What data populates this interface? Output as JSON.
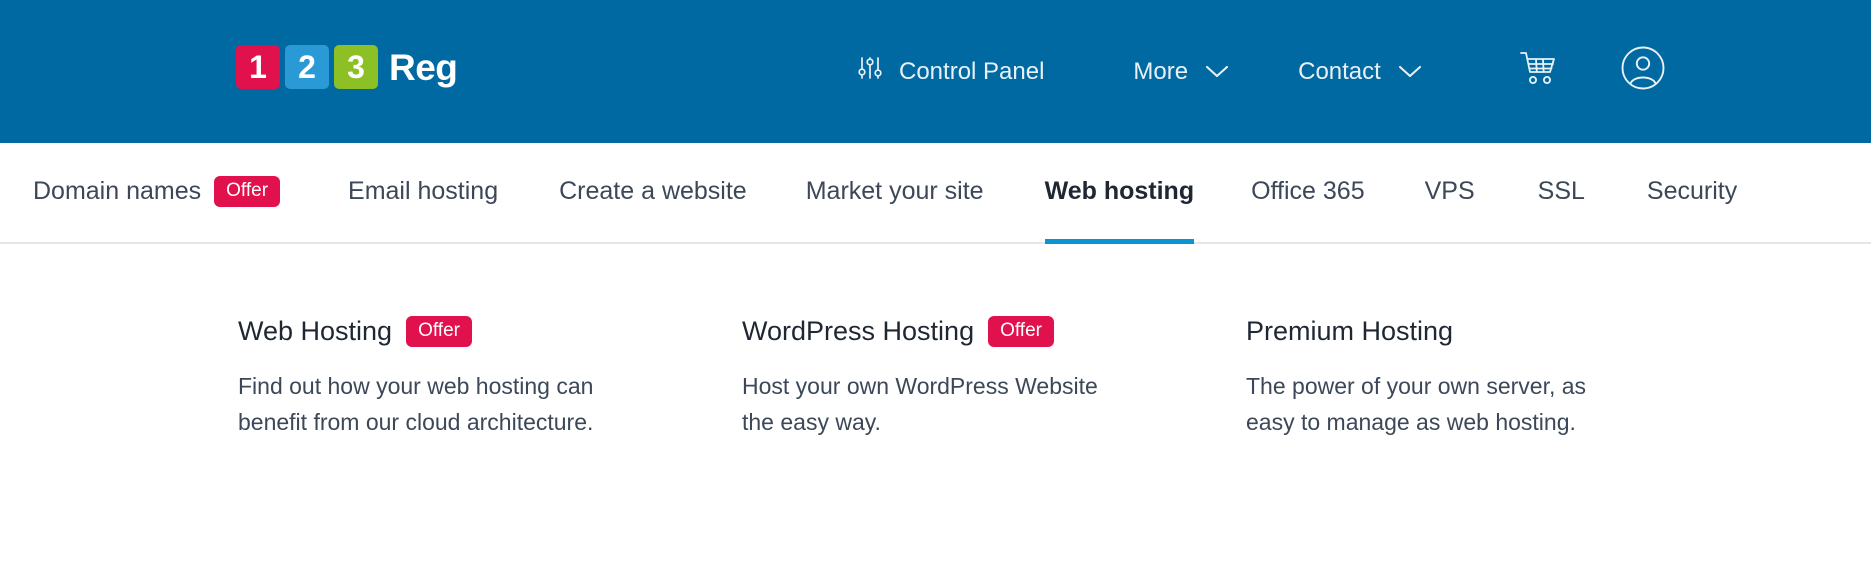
{
  "colors": {
    "header_blue": "#0069a2",
    "accent_blue": "#0d93d2",
    "badge_pink": "#e0114d",
    "logo_1": "#e0114d",
    "logo_2": "#2a9ad6",
    "logo_3": "#8cc024",
    "text_dark": "#1f2733",
    "text_body": "#3c4858"
  },
  "header": {
    "logo": {
      "tiles": [
        "1",
        "2",
        "3"
      ],
      "word": "Reg"
    },
    "items": [
      {
        "label": "Control Panel",
        "icon": "sliders-icon"
      },
      {
        "label": "More",
        "icon": "chevron-down-icon"
      },
      {
        "label": "Contact",
        "icon": "chevron-down-icon"
      }
    ],
    "cart_icon": "shopping-cart-icon",
    "account_icon": "user-account-icon"
  },
  "main_nav": {
    "items": [
      {
        "label": "Domain names",
        "badge": "Offer",
        "active": false
      },
      {
        "label": "Email hosting",
        "badge": null,
        "active": false
      },
      {
        "label": "Create a website",
        "badge": null,
        "active": false
      },
      {
        "label": "Market your site",
        "badge": null,
        "active": false
      },
      {
        "label": "Web hosting",
        "badge": null,
        "active": true
      },
      {
        "label": "Office 365",
        "badge": null,
        "active": false
      },
      {
        "label": "VPS",
        "badge": null,
        "active": false
      },
      {
        "label": "SSL",
        "badge": null,
        "active": false
      },
      {
        "label": "Security",
        "badge": null,
        "active": false
      }
    ]
  },
  "mega_panel": {
    "columns": [
      {
        "title": "Web Hosting",
        "badge": "Offer",
        "description": "Find out how your web hosting can benefit from our cloud architecture."
      },
      {
        "title": "WordPress Hosting",
        "badge": "Offer",
        "description": "Host your own WordPress Website the easy way."
      },
      {
        "title": "Premium Hosting",
        "badge": null,
        "description": "The power of your own server, as easy to manage as web hosting."
      }
    ]
  }
}
